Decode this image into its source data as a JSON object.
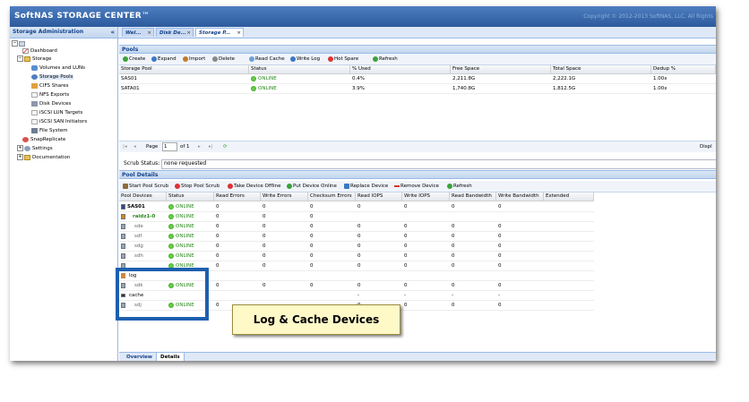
{
  "app": {
    "logo": "SoftNAS",
    "title": "STORAGE CENTER",
    "tm": "™",
    "copyright": "Copyright © 2012-2013 SoftNAS, LLC. All Rights"
  },
  "sidebar": {
    "header": "Storage Administration",
    "collapse": "«",
    "items": [
      {
        "label": "Dashboard",
        "icon": "dashboard-icon"
      },
      {
        "label": "Storage",
        "icon": "folder-icon"
      },
      {
        "label": "Volumes and LUNs",
        "icon": "volume-icon"
      },
      {
        "label": "Storage Pools",
        "icon": "pool-icon"
      },
      {
        "label": "CIFS Shares",
        "icon": "share-icon"
      },
      {
        "label": "NFS Exports",
        "icon": "export-icon"
      },
      {
        "label": "Disk Devices",
        "icon": "disk-icon"
      },
      {
        "label": "iSCSI LUN Targets",
        "icon": "target-icon"
      },
      {
        "label": "iSCSI SAN Initiators",
        "icon": "initiator-icon"
      },
      {
        "label": "File System",
        "icon": "filesystem-icon"
      },
      {
        "label": "SnapReplicate",
        "icon": "replicate-icon"
      },
      {
        "label": "Settings",
        "icon": "gear-icon"
      },
      {
        "label": "Documentation",
        "icon": "folder-icon"
      }
    ]
  },
  "tabs": [
    {
      "label": "Wel...",
      "close": "×"
    },
    {
      "label": "Disk De...",
      "close": "×"
    },
    {
      "label": "Storage P...",
      "close": "×"
    }
  ],
  "pools": {
    "title": "Pools",
    "toolbar": [
      "Create",
      "Expand",
      "Import",
      "Delete",
      "Read Cache",
      "Write Log",
      "Hot Spare",
      "Refresh"
    ],
    "columns": [
      "Storage Pool",
      "Status",
      "% Used",
      "Free Space",
      "Total Space",
      "Dedup %"
    ],
    "rows": [
      {
        "name": "SAS01",
        "status": "ONLINE",
        "used": "0.4%",
        "free": "2,211.8G",
        "total": "2,222.1G",
        "dedup": "1.00x"
      },
      {
        "name": "SATA01",
        "status": "ONLINE",
        "used": "3.9%",
        "free": "1,740.8G",
        "total": "1,812.5G",
        "dedup": "1.00x"
      }
    ],
    "pager": {
      "page_label": "Page",
      "page": "1",
      "of": "of 1",
      "display": "Displ"
    }
  },
  "scrub": {
    "label": "Scrub Status:",
    "value": "none requested"
  },
  "details": {
    "title": "Pool Details",
    "toolbar": [
      "Start Pool Scrub",
      "Stop Pool Scrub",
      "Take Device Offline",
      "Put Device Online",
      "Replace Device",
      "Remove Device",
      "Refresh"
    ],
    "columns": [
      "Pool Devices",
      "Status",
      "Read Errors",
      "Write Errors",
      "Checksum Errors",
      "Read IOPS",
      "Write IOPS",
      "Read Bandwidth",
      "Write Bandwidth",
      "Extended"
    ],
    "rows": [
      {
        "dev": "SAS01",
        "status": "ONLINE",
        "re": "0",
        "we": "0",
        "ce": "0",
        "ri": "0",
        "wi": "0",
        "rb": "0",
        "wb": "0"
      },
      {
        "dev": "raidz1-0",
        "status": "ONLINE",
        "re": "0",
        "we": "0",
        "ce": "0",
        "ri": "",
        "wi": "",
        "rb": "",
        "wb": ""
      },
      {
        "dev": "sde",
        "status": "ONLINE",
        "re": "0",
        "we": "0",
        "ce": "0",
        "ri": "0",
        "wi": "0",
        "rb": "0",
        "wb": "0"
      },
      {
        "dev": "sdf",
        "status": "ONLINE",
        "re": "0",
        "we": "0",
        "ce": "0",
        "ri": "0",
        "wi": "0",
        "rb": "0",
        "wb": "0"
      },
      {
        "dev": "sdg",
        "status": "ONLINE",
        "re": "0",
        "we": "0",
        "ce": "0",
        "ri": "0",
        "wi": "0",
        "rb": "0",
        "wb": "0"
      },
      {
        "dev": "sdh",
        "status": "ONLINE",
        "re": "0",
        "we": "0",
        "ce": "0",
        "ri": "0",
        "wi": "0",
        "rb": "0",
        "wb": "0"
      },
      {
        "dev": "",
        "status": "ONLINE",
        "re": "0",
        "we": "0",
        "ce": "0",
        "ri": "0",
        "wi": "0",
        "rb": "0",
        "wb": "0"
      },
      {
        "dev": "log",
        "status": "",
        "re": "",
        "we": "",
        "ce": "",
        "ri": "",
        "wi": "",
        "rb": "",
        "wb": ""
      },
      {
        "dev": "sdk",
        "status": "ONLINE",
        "re": "0",
        "we": "0",
        "ce": "0",
        "ri": "0",
        "wi": "0",
        "rb": "0",
        "wb": "0"
      },
      {
        "dev": "cache",
        "status": "",
        "re": "",
        "we": "",
        "ce": "",
        "ri": "-",
        "wi": "-",
        "rb": "-",
        "wb": "-"
      },
      {
        "dev": "sdj",
        "status": "ONLINE",
        "re": "0",
        "we": "",
        "ce": "",
        "ri": "0",
        "wi": "0",
        "rb": "0",
        "wb": "0"
      }
    ]
  },
  "bottom_tabs": [
    "Overview",
    "Details"
  ],
  "callout": "Log & Cache Devices",
  "colors": {
    "header": "#2c5a9c",
    "online": "#2b8a1e",
    "highlight": "#1e5faf",
    "callout_bg": "#fff9c8"
  }
}
